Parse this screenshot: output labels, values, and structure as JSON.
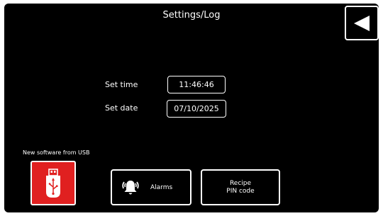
{
  "header": {
    "title": "Settings/Log"
  },
  "back_button": {
    "icon": "back-triangle-icon"
  },
  "time": {
    "label": "Set time",
    "value": "11:46:46"
  },
  "date": {
    "label": "Set date",
    "value": "07/10/2025"
  },
  "usb": {
    "caption": "New software from USB",
    "icon": "usb-stick-icon"
  },
  "buttons": {
    "alarms_label": "Alarms",
    "alarms_icon": "alarm-bell-icon",
    "recipe_line1": "Recipe",
    "recipe_line2": "PIN code"
  },
  "colors": {
    "background": "#000000",
    "foreground": "#ffffff",
    "usb_accent": "#e02020"
  }
}
